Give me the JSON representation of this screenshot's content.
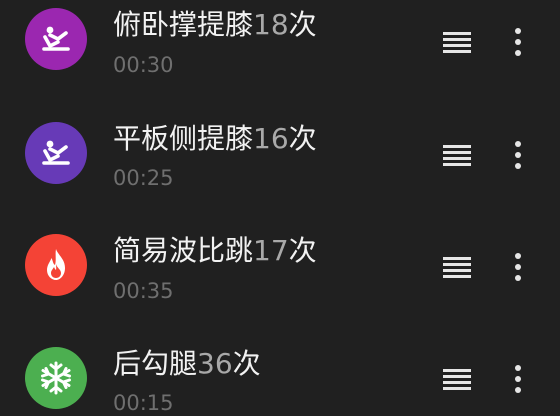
{
  "exercises": [
    {
      "name": "俯卧撑提膝",
      "count": "18",
      "unit": "次",
      "duration": "00:30",
      "icon": "situp-icon",
      "color": "#9b27b0"
    },
    {
      "name": "平板侧提膝",
      "count": "16",
      "unit": "次",
      "duration": "00:25",
      "icon": "situp-icon",
      "color": "#673ab7"
    },
    {
      "name": "简易波比跳",
      "count": "17",
      "unit": "次",
      "duration": "00:35",
      "icon": "flame-icon",
      "color": "#f44336"
    },
    {
      "name": "后勾腿",
      "count": "36",
      "unit": "次",
      "duration": "00:15",
      "icon": "snowflake-icon",
      "color": "#4caf50"
    }
  ],
  "colors": {
    "background": "#202020",
    "title": "#f2f2f2",
    "count": "#a9a9a9",
    "duration": "#6f6f6f",
    "icons": "#e6e6e6"
  }
}
